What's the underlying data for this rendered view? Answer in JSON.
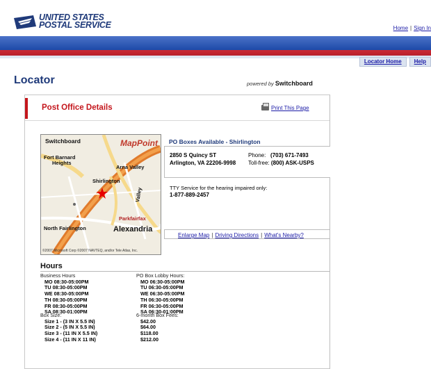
{
  "header": {
    "logo_line1": "UNITED STATES",
    "logo_line2": "POSTAL SERVICE",
    "links": [
      "Home",
      "Sign In"
    ],
    "subnav": [
      "Locator Home",
      "Help"
    ]
  },
  "page": {
    "title": "Locator",
    "powered_by": "powered by",
    "powered_brand": "Switchboard"
  },
  "details": {
    "title": "Post Office Details",
    "print_label": "Print This Page",
    "po_name": "PO Boxes Available - Shirlington",
    "address_line1": "2850 S Quincy ST",
    "address_line2": "Arlington, VA 22206-9998",
    "phone_label": "Phone:",
    "phone_value": "(703) 671-7493",
    "tollfree_label": "Toll-free:",
    "tollfree_value": "(800) ASK-USPS",
    "tty_text": "TTY Service for the hearing impaired only:",
    "tty_number": "1-877-889-2457",
    "map_links": [
      "Enlarge Map",
      "Driving Directions",
      "What's Nearby?"
    ]
  },
  "map": {
    "brand": "Switchboard",
    "mappoint": "MapPoint",
    "labels": {
      "fort_barnard": "Fort Barnard",
      "heights": "Heights",
      "arna_valley": "Arna Valley",
      "shirlington": "Shirlington",
      "valley": "Valley",
      "parkfairfax": "Parkfairfax",
      "north_fairlington": "North Fairlington",
      "alexandria": "Alexandria"
    },
    "copyright": "©2007 Microsoft Corp ©2007 NAVTEQ, and/or Tele Atlas, Inc."
  },
  "hours": {
    "title": "Hours",
    "business_header": "Business Hours",
    "business": [
      "MO 08:30-05:00PM",
      "TU 08:30-05:00PM",
      "WE 08:30-05:00PM",
      "TH 08:30-05:00PM",
      "FR 08:30-05:00PM",
      "SA 08:30-01:00PM"
    ],
    "lobby_header": "PO Box Lobby Hours:",
    "lobby": [
      "MO 06:30-05:00PM",
      "TU 06:30-05:00PM",
      "WE 06:30-05:00PM",
      "TH 06:30-05:00PM",
      "FR 06:30-05:00PM",
      "SA 06:30-01:00PM"
    ],
    "box_size_header": "Box Size:",
    "box_sizes": [
      "Size 1 - (3 IN X 5.5 IN)",
      "Size 2 - (5 IN X 5.5 IN)",
      "Size 3 - (11 IN X 5.5 IN)",
      "Size 4 - (11 IN X 11 IN)"
    ],
    "fees_header": "6-month Box Fees:",
    "fees": [
      "$42.00",
      "$64.00",
      "$118.00",
      "$212.00"
    ]
  },
  "colors": {
    "brand_blue": "#1f3a7a",
    "band_blue": "#1d4aa8",
    "band_red": "#c4161c",
    "link": "#1a1aa6"
  }
}
